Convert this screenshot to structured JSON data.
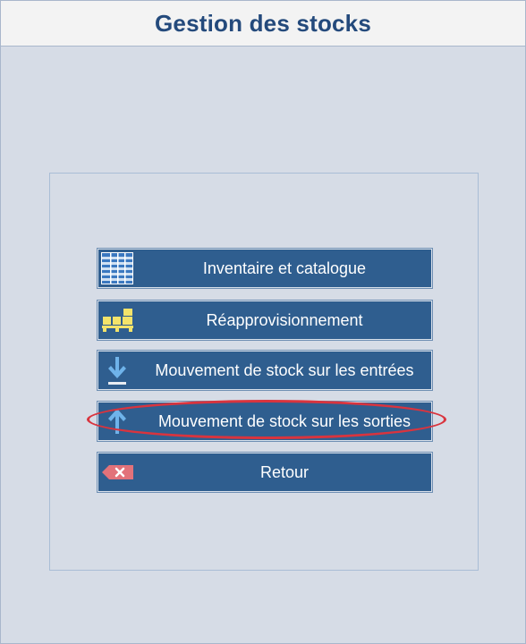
{
  "header": {
    "title": "Gestion des stocks"
  },
  "menu": {
    "items": [
      {
        "label": "Inventaire et catalogue",
        "icon": "catalog-grid-icon"
      },
      {
        "label": "Réapprovisionnement",
        "icon": "pallet-boxes-icon"
      },
      {
        "label": "Mouvement de stock sur les entrées",
        "icon": "arrow-down-in-icon"
      },
      {
        "label": "Mouvement de stock sur les sorties",
        "icon": "arrow-up-out-icon"
      },
      {
        "label": "Retour",
        "icon": "backspace-icon"
      }
    ]
  },
  "colors": {
    "background": "#d6dce6",
    "header_text": "#244a7c",
    "button": "#2f5e8f",
    "highlight": "#d9343e"
  }
}
